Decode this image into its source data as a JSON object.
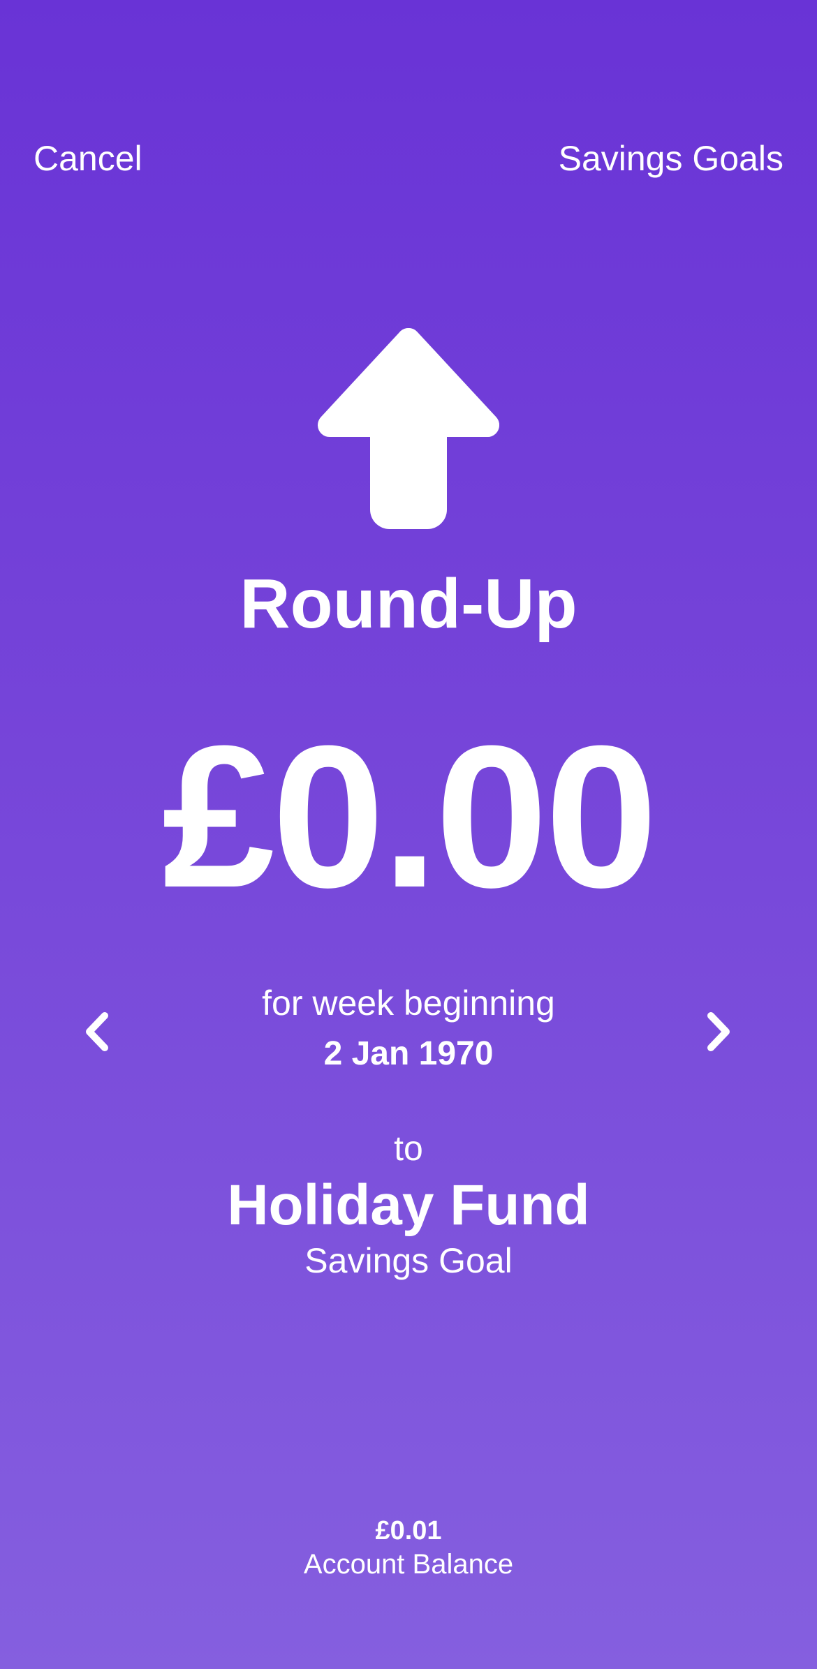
{
  "nav": {
    "cancel_label": "Cancel",
    "savings_goals_label": "Savings Goals"
  },
  "hero": {
    "icon": "arrow-up-icon",
    "title": "Round-Up",
    "amount": "£0.00"
  },
  "period": {
    "label": "for week beginning",
    "date": "2 Jan 1970",
    "prev_icon": "chevron-left-icon",
    "next_icon": "chevron-right-icon"
  },
  "destination": {
    "to_label": "to",
    "goal_name": "Holiday Fund",
    "goal_type": "Savings Goal"
  },
  "account": {
    "balance": "£0.01",
    "balance_label": "Account Balance"
  },
  "colors": {
    "background_top": "#6933d6",
    "background_bottom": "#855fdf",
    "foreground": "#ffffff"
  }
}
